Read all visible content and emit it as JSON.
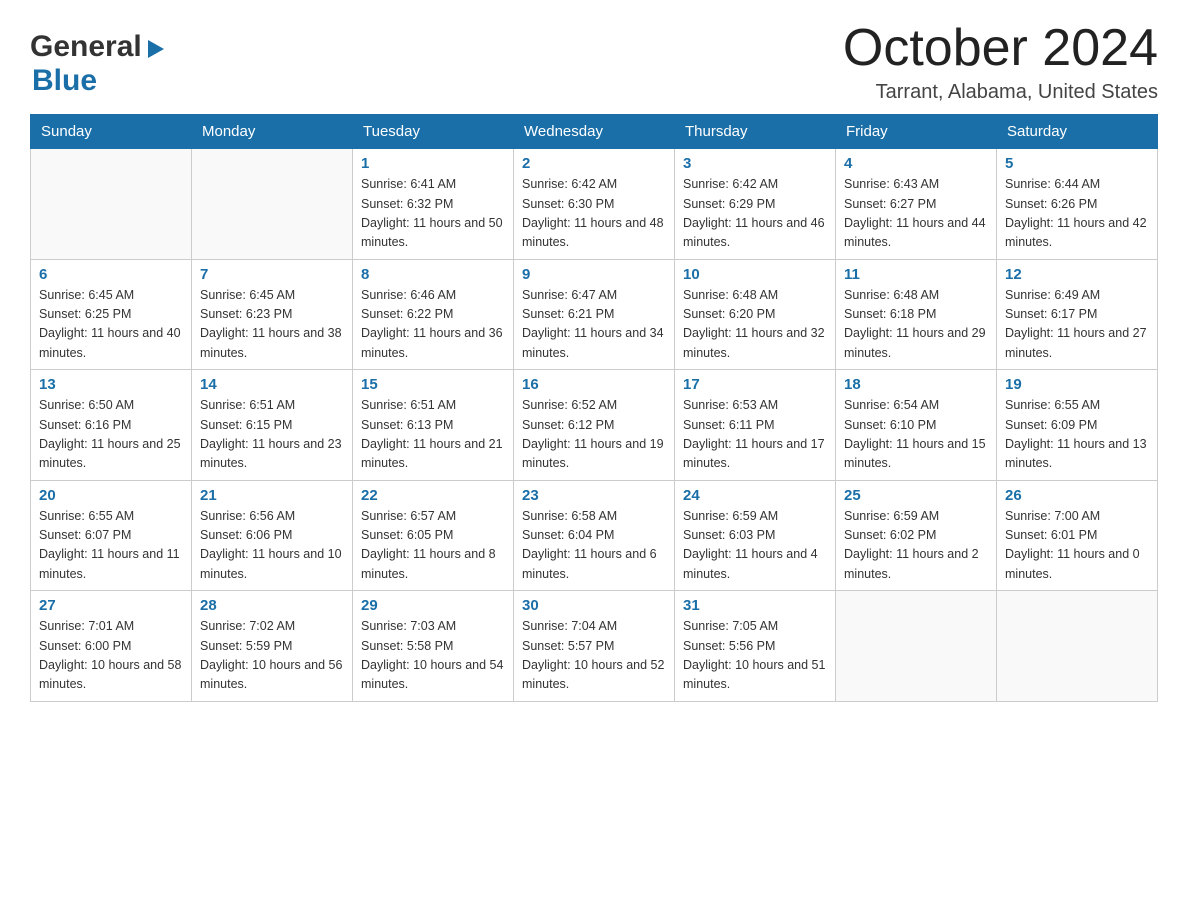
{
  "header": {
    "logo_general": "General",
    "logo_blue": "Blue",
    "month_title": "October 2024",
    "location": "Tarrant, Alabama, United States"
  },
  "days_of_week": [
    "Sunday",
    "Monday",
    "Tuesday",
    "Wednesday",
    "Thursday",
    "Friday",
    "Saturday"
  ],
  "weeks": [
    [
      {
        "day": "",
        "sunrise": "",
        "sunset": "",
        "daylight": ""
      },
      {
        "day": "",
        "sunrise": "",
        "sunset": "",
        "daylight": ""
      },
      {
        "day": "1",
        "sunrise": "Sunrise: 6:41 AM",
        "sunset": "Sunset: 6:32 PM",
        "daylight": "Daylight: 11 hours and 50 minutes."
      },
      {
        "day": "2",
        "sunrise": "Sunrise: 6:42 AM",
        "sunset": "Sunset: 6:30 PM",
        "daylight": "Daylight: 11 hours and 48 minutes."
      },
      {
        "day": "3",
        "sunrise": "Sunrise: 6:42 AM",
        "sunset": "Sunset: 6:29 PM",
        "daylight": "Daylight: 11 hours and 46 minutes."
      },
      {
        "day": "4",
        "sunrise": "Sunrise: 6:43 AM",
        "sunset": "Sunset: 6:27 PM",
        "daylight": "Daylight: 11 hours and 44 minutes."
      },
      {
        "day": "5",
        "sunrise": "Sunrise: 6:44 AM",
        "sunset": "Sunset: 6:26 PM",
        "daylight": "Daylight: 11 hours and 42 minutes."
      }
    ],
    [
      {
        "day": "6",
        "sunrise": "Sunrise: 6:45 AM",
        "sunset": "Sunset: 6:25 PM",
        "daylight": "Daylight: 11 hours and 40 minutes."
      },
      {
        "day": "7",
        "sunrise": "Sunrise: 6:45 AM",
        "sunset": "Sunset: 6:23 PM",
        "daylight": "Daylight: 11 hours and 38 minutes."
      },
      {
        "day": "8",
        "sunrise": "Sunrise: 6:46 AM",
        "sunset": "Sunset: 6:22 PM",
        "daylight": "Daylight: 11 hours and 36 minutes."
      },
      {
        "day": "9",
        "sunrise": "Sunrise: 6:47 AM",
        "sunset": "Sunset: 6:21 PM",
        "daylight": "Daylight: 11 hours and 34 minutes."
      },
      {
        "day": "10",
        "sunrise": "Sunrise: 6:48 AM",
        "sunset": "Sunset: 6:20 PM",
        "daylight": "Daylight: 11 hours and 32 minutes."
      },
      {
        "day": "11",
        "sunrise": "Sunrise: 6:48 AM",
        "sunset": "Sunset: 6:18 PM",
        "daylight": "Daylight: 11 hours and 29 minutes."
      },
      {
        "day": "12",
        "sunrise": "Sunrise: 6:49 AM",
        "sunset": "Sunset: 6:17 PM",
        "daylight": "Daylight: 11 hours and 27 minutes."
      }
    ],
    [
      {
        "day": "13",
        "sunrise": "Sunrise: 6:50 AM",
        "sunset": "Sunset: 6:16 PM",
        "daylight": "Daylight: 11 hours and 25 minutes."
      },
      {
        "day": "14",
        "sunrise": "Sunrise: 6:51 AM",
        "sunset": "Sunset: 6:15 PM",
        "daylight": "Daylight: 11 hours and 23 minutes."
      },
      {
        "day": "15",
        "sunrise": "Sunrise: 6:51 AM",
        "sunset": "Sunset: 6:13 PM",
        "daylight": "Daylight: 11 hours and 21 minutes."
      },
      {
        "day": "16",
        "sunrise": "Sunrise: 6:52 AM",
        "sunset": "Sunset: 6:12 PM",
        "daylight": "Daylight: 11 hours and 19 minutes."
      },
      {
        "day": "17",
        "sunrise": "Sunrise: 6:53 AM",
        "sunset": "Sunset: 6:11 PM",
        "daylight": "Daylight: 11 hours and 17 minutes."
      },
      {
        "day": "18",
        "sunrise": "Sunrise: 6:54 AM",
        "sunset": "Sunset: 6:10 PM",
        "daylight": "Daylight: 11 hours and 15 minutes."
      },
      {
        "day": "19",
        "sunrise": "Sunrise: 6:55 AM",
        "sunset": "Sunset: 6:09 PM",
        "daylight": "Daylight: 11 hours and 13 minutes."
      }
    ],
    [
      {
        "day": "20",
        "sunrise": "Sunrise: 6:55 AM",
        "sunset": "Sunset: 6:07 PM",
        "daylight": "Daylight: 11 hours and 11 minutes."
      },
      {
        "day": "21",
        "sunrise": "Sunrise: 6:56 AM",
        "sunset": "Sunset: 6:06 PM",
        "daylight": "Daylight: 11 hours and 10 minutes."
      },
      {
        "day": "22",
        "sunrise": "Sunrise: 6:57 AM",
        "sunset": "Sunset: 6:05 PM",
        "daylight": "Daylight: 11 hours and 8 minutes."
      },
      {
        "day": "23",
        "sunrise": "Sunrise: 6:58 AM",
        "sunset": "Sunset: 6:04 PM",
        "daylight": "Daylight: 11 hours and 6 minutes."
      },
      {
        "day": "24",
        "sunrise": "Sunrise: 6:59 AM",
        "sunset": "Sunset: 6:03 PM",
        "daylight": "Daylight: 11 hours and 4 minutes."
      },
      {
        "day": "25",
        "sunrise": "Sunrise: 6:59 AM",
        "sunset": "Sunset: 6:02 PM",
        "daylight": "Daylight: 11 hours and 2 minutes."
      },
      {
        "day": "26",
        "sunrise": "Sunrise: 7:00 AM",
        "sunset": "Sunset: 6:01 PM",
        "daylight": "Daylight: 11 hours and 0 minutes."
      }
    ],
    [
      {
        "day": "27",
        "sunrise": "Sunrise: 7:01 AM",
        "sunset": "Sunset: 6:00 PM",
        "daylight": "Daylight: 10 hours and 58 minutes."
      },
      {
        "day": "28",
        "sunrise": "Sunrise: 7:02 AM",
        "sunset": "Sunset: 5:59 PM",
        "daylight": "Daylight: 10 hours and 56 minutes."
      },
      {
        "day": "29",
        "sunrise": "Sunrise: 7:03 AM",
        "sunset": "Sunset: 5:58 PM",
        "daylight": "Daylight: 10 hours and 54 minutes."
      },
      {
        "day": "30",
        "sunrise": "Sunrise: 7:04 AM",
        "sunset": "Sunset: 5:57 PM",
        "daylight": "Daylight: 10 hours and 52 minutes."
      },
      {
        "day": "31",
        "sunrise": "Sunrise: 7:05 AM",
        "sunset": "Sunset: 5:56 PM",
        "daylight": "Daylight: 10 hours and 51 minutes."
      },
      {
        "day": "",
        "sunrise": "",
        "sunset": "",
        "daylight": ""
      },
      {
        "day": "",
        "sunrise": "",
        "sunset": "",
        "daylight": ""
      }
    ]
  ]
}
